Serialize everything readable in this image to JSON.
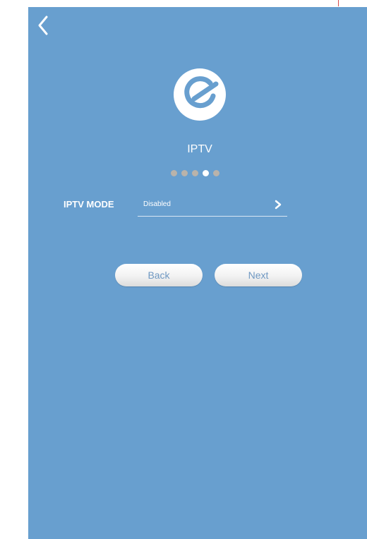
{
  "colors": {
    "background": "#689fcf",
    "text": "#ffffff",
    "dot_inactive": "#b9b3ab",
    "dot_active": "#ffffff",
    "button_text": "#6f98c2",
    "button_background": "#f2f2f2"
  },
  "header": {
    "back_icon": "chevron-left-icon"
  },
  "logo": {
    "icon": "logo-icon"
  },
  "page": {
    "title": "IPTV"
  },
  "progress": {
    "total_steps": 5,
    "current_step": 4
  },
  "iptv_mode": {
    "label": "IPTV MODE",
    "value": "Disabled",
    "arrow_icon": "chevron-right-icon"
  },
  "buttons": {
    "back_label": "Back",
    "next_label": "Next"
  }
}
